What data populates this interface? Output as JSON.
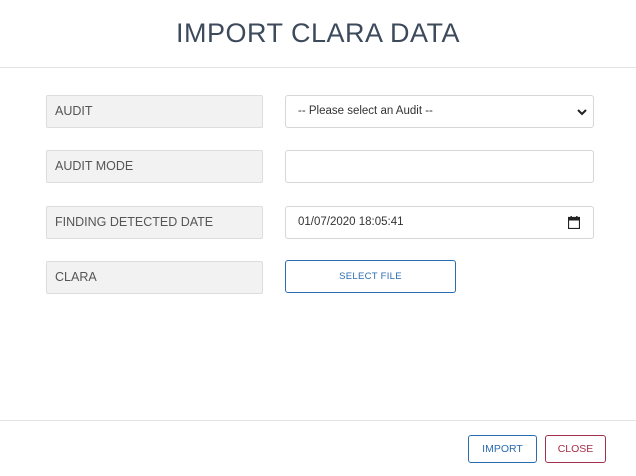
{
  "dialog": {
    "title": "IMPORT CLARA DATA"
  },
  "form": {
    "audit": {
      "label": "AUDIT",
      "selected": "-- Please select an Audit --"
    },
    "audit_mode": {
      "label": "AUDIT MODE",
      "value": ""
    },
    "finding_detected_date": {
      "label": "FINDING DETECTED DATE",
      "value": "01/07/2020 18:05:41"
    },
    "clara": {
      "label": "CLARA",
      "button_label": "SELECT FILE"
    }
  },
  "footer": {
    "import_label": "IMPORT",
    "close_label": "CLOSE"
  },
  "colors": {
    "primary": "#2b6cb0",
    "danger": "#a3304a",
    "title": "#3d4a5c"
  },
  "icons": {
    "select_arrow": "chevron-down-icon",
    "date_picker": "calendar-icon"
  }
}
